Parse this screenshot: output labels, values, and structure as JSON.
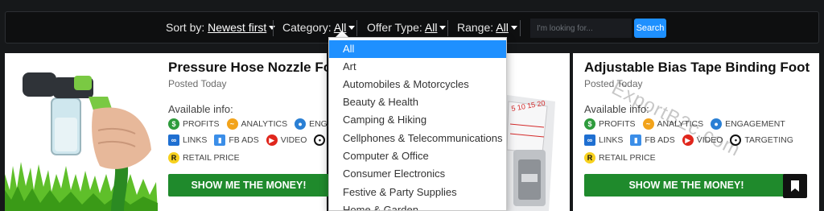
{
  "filter_bar": {
    "sort_label": "Sort by:",
    "sort_value": "Newest first",
    "category_label": "Category:",
    "category_value": "All",
    "offer_label": "Offer Type:",
    "offer_value": "All",
    "range_label": "Range:",
    "range_value": "All",
    "search_placeholder": "I'm looking for...",
    "search_button": "Search"
  },
  "category_dropdown": {
    "items": [
      "All",
      "Art",
      "Automobiles & Motorcycles",
      "Beauty & Health",
      "Camping & Hiking",
      "Cellphones & Telecommunications",
      "Computer & Office",
      "Consumer Electronics",
      "Festive & Party Supplies",
      "Home & Garden"
    ],
    "selected": "All"
  },
  "products": [
    {
      "title": "Pressure Hose Nozzle Foam",
      "posted": "Posted Today",
      "available_label": "Available info:",
      "info_row1": [
        "PROFITS",
        "ANALYTICS",
        "ENGAG"
      ],
      "info_row2": [
        "LINKS",
        "FB ADS",
        "VIDEO"
      ],
      "info_row3": [
        "RETAIL PRICE"
      ],
      "cta": "SHOW ME THE MONEY!"
    },
    {
      "title": "Adjustable Bias Tape Binding Foot",
      "posted": "Posted Today",
      "available_label": "Available info:",
      "info_row1": [
        "PROFITS",
        "ANALYTICS",
        "ENGAGEMENT"
      ],
      "info_row2": [
        "LINKS",
        "FB ADS",
        "VIDEO",
        "TARGETING"
      ],
      "info_row3": [
        "RETAIL PRICE"
      ],
      "cta": "SHOW ME THE MONEY!"
    }
  ],
  "watermark": "ExportB2c.com",
  "colors": {
    "accent_blue": "#1e90ff",
    "cta_green": "#1f8a2c",
    "background": "#16181a"
  }
}
